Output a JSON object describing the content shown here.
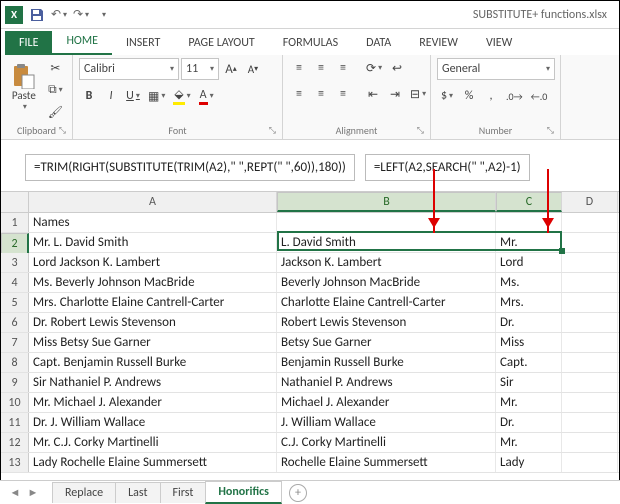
{
  "titlebar": {
    "filename": "SUBSTITUTE+ functions.xlsx"
  },
  "menutabs": {
    "file": "FILE",
    "home": "HOME",
    "insert": "INSERT",
    "pagelayout": "PAGE LAYOUT",
    "formulas": "FORMULAS",
    "data": "DATA",
    "review": "REVIEW",
    "view": "VIEW"
  },
  "ribbon": {
    "clipboard": {
      "paste": "Paste",
      "label": "Clipboard"
    },
    "font": {
      "name": "Calibri",
      "size": "11",
      "label": "Font",
      "bold": "B",
      "italic": "I",
      "underline": "U"
    },
    "alignment": {
      "label": "Alignment"
    },
    "number": {
      "format": "General",
      "label": "Number",
      "pct": "%",
      "comma": ",",
      "dec_inc": ".0←",
      "dec_dec": "→.0",
      "cur": "$"
    }
  },
  "formulas": {
    "b": "=TRIM(RIGHT(SUBSTITUTE(TRIM(A2),\" \",REPT(\" \",60)),180))",
    "c": "=LEFT(A2,SEARCH(\" \",A2)-1)"
  },
  "columns": {
    "A": "A",
    "B": "B",
    "C": "C",
    "D": "D"
  },
  "colA_header": "Names",
  "rows": [
    {
      "n": "1",
      "a": "Names",
      "b": "",
      "c": ""
    },
    {
      "n": "2",
      "a": "Mr. L. David Smith",
      "b": "L. David Smith",
      "c": "Mr."
    },
    {
      "n": "3",
      "a": "Lord Jackson K. Lambert",
      "b": "Jackson K. Lambert",
      "c": "Lord"
    },
    {
      "n": "4",
      "a": "Ms. Beverly Johnson MacBride",
      "b": "Beverly Johnson MacBride",
      "c": "Ms."
    },
    {
      "n": "5",
      "a": "Mrs. Charlotte Elaine Cantrell-Carter",
      "b": "Charlotte Elaine Cantrell-Carter",
      "c": "Mrs."
    },
    {
      "n": "6",
      "a": "Dr. Robert Lewis Stevenson",
      "b": "Robert Lewis Stevenson",
      "c": "Dr."
    },
    {
      "n": "7",
      "a": "Miss Betsy Sue Garner",
      "b": "Betsy Sue Garner",
      "c": "Miss"
    },
    {
      "n": "8",
      "a": "Capt. Benjamin Russell Burke",
      "b": "Benjamin Russell Burke",
      "c": "Capt."
    },
    {
      "n": "9",
      "a": "Sir Nathaniel P. Andrews",
      "b": "Nathaniel P. Andrews",
      "c": "Sir"
    },
    {
      "n": "10",
      "a": "Mr. Michael J. Alexander",
      "b": "Michael J. Alexander",
      "c": "Mr."
    },
    {
      "n": "11",
      "a": "Dr. J. William Wallace",
      "b": "J. William Wallace",
      "c": "Dr."
    },
    {
      "n": "12",
      "a": "Mr. C.J. Corky Martinelli",
      "b": "C.J. Corky Martinelli",
      "c": "Mr."
    },
    {
      "n": "13",
      "a": "Lady Rochelle Elaine Summersett",
      "b": "Rochelle Elaine Summersett",
      "c": "Lady"
    }
  ],
  "sheets": {
    "replace": "Replace",
    "last": "Last",
    "first": "First",
    "honorifics": "Honorifics"
  }
}
